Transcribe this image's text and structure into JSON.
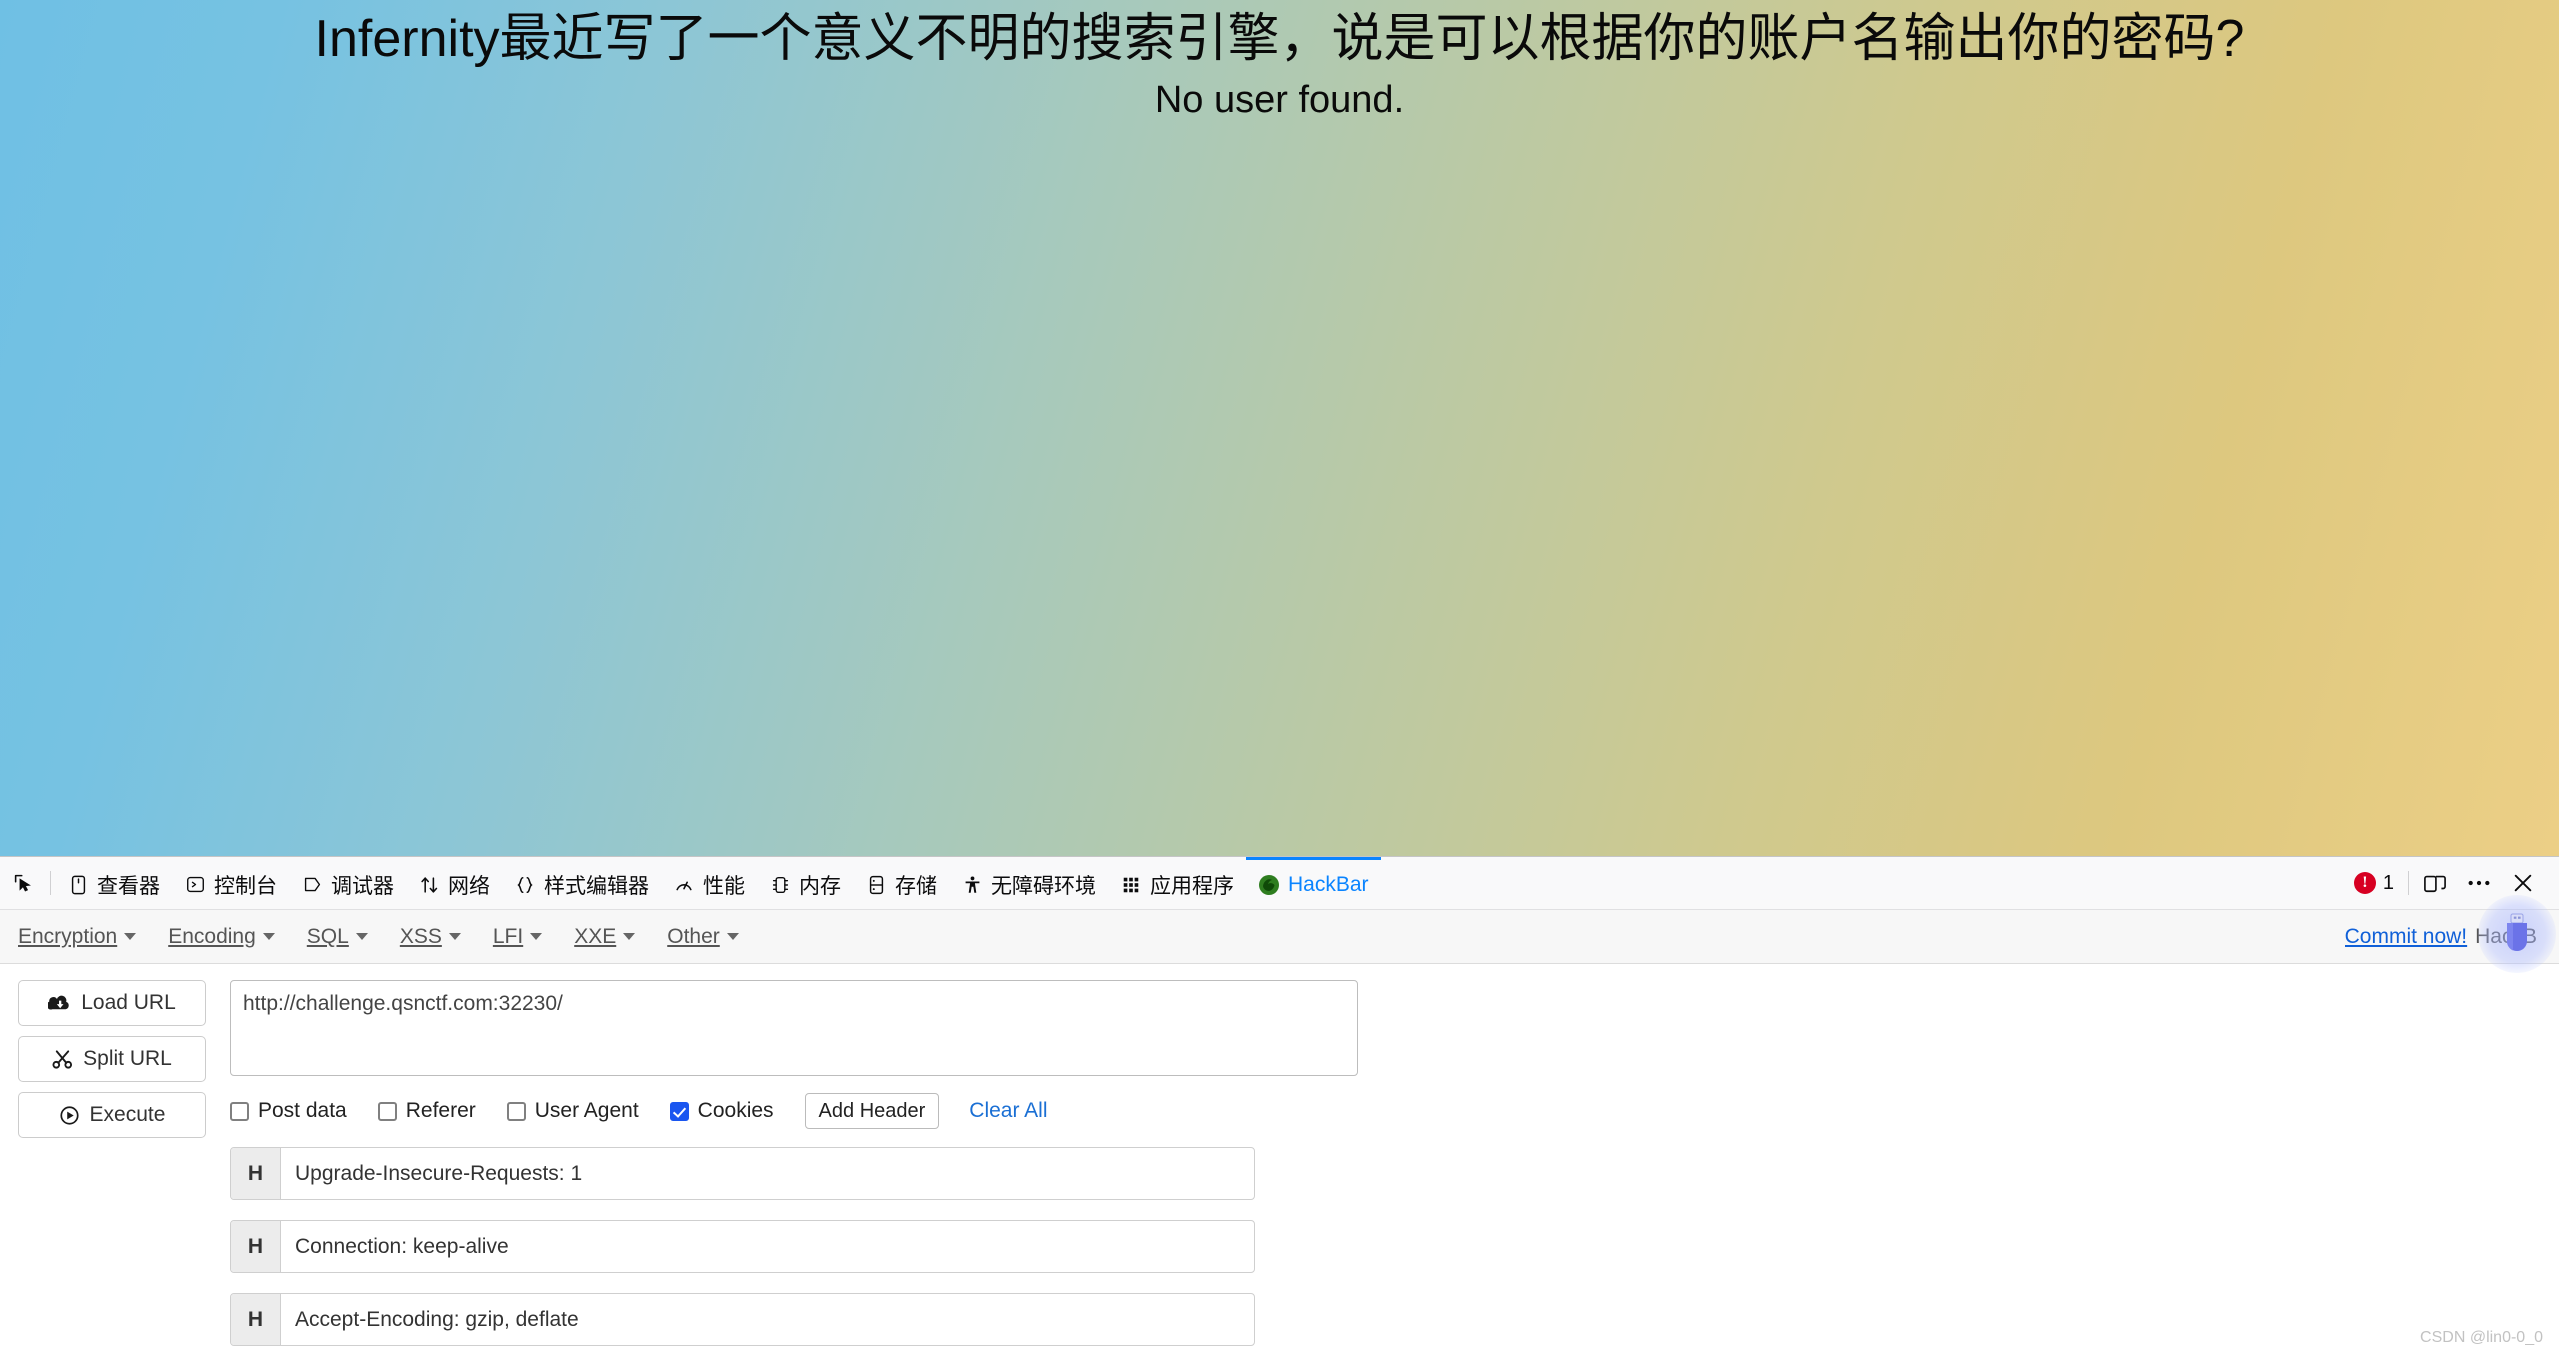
{
  "page": {
    "title": "Infernity最近写了一个意义不明的搜索引擎，说是可以根据你的账户名输出你的密码?",
    "message": "No user found.",
    "background_from": "#6fc0e4",
    "background_to": "#eccf86"
  },
  "devtools": {
    "picker_icon": "element-picker-icon",
    "tabs": [
      {
        "label": "查看器",
        "icon": "inspector-icon",
        "active": false
      },
      {
        "label": "控制台",
        "icon": "console-icon",
        "active": false
      },
      {
        "label": "调试器",
        "icon": "debugger-icon",
        "active": false
      },
      {
        "label": "网络",
        "icon": "network-icon",
        "active": false
      },
      {
        "label": "样式编辑器",
        "icon": "style-editor-icon",
        "active": false
      },
      {
        "label": "性能",
        "icon": "performance-icon",
        "active": false
      },
      {
        "label": "内存",
        "icon": "memory-icon",
        "active": false
      },
      {
        "label": "存储",
        "icon": "storage-icon",
        "active": false
      },
      {
        "label": "无障碍环境",
        "icon": "accessibility-icon",
        "active": false
      },
      {
        "label": "应用程序",
        "icon": "application-icon",
        "active": false
      },
      {
        "label": "HackBar",
        "icon": "hackbar-firefox-icon",
        "active": true
      }
    ],
    "error_badge": {
      "symbol": "!",
      "count": "1",
      "color": "#d70022"
    },
    "responsive_icon": "responsive-design-mode-icon",
    "meatball_icon": "more-options-icon",
    "close_icon": "close-icon",
    "active_tab_accent": "#0a84ff"
  },
  "hackbar": {
    "menus": [
      {
        "label": "Encryption"
      },
      {
        "label": "Encoding"
      },
      {
        "label": "SQL"
      },
      {
        "label": "XSS"
      },
      {
        "label": "LFI"
      },
      {
        "label": "XXE"
      },
      {
        "label": "Other"
      }
    ],
    "commit_link": "Commit now!",
    "brand_text": "HackB",
    "actions": [
      {
        "label": "Load URL",
        "icon": "cloud-download-icon"
      },
      {
        "label": "Split URL",
        "icon": "scissors-icon"
      },
      {
        "label": "Execute",
        "icon": "play-icon"
      }
    ],
    "url_field": {
      "value": "http://challenge.qsnctf.com:32230/",
      "placeholder": "http://"
    },
    "options": [
      {
        "label": "Post data",
        "checked": false
      },
      {
        "label": "Referer",
        "checked": false
      },
      {
        "label": "User Agent",
        "checked": false
      },
      {
        "label": "Cookies",
        "checked": true
      }
    ],
    "add_header_label": "Add Header",
    "clear_all_label": "Clear All",
    "header_tag": "H",
    "headers": [
      {
        "value": "Upgrade-Insecure-Requests: 1"
      },
      {
        "value": "Connection: keep-alive"
      },
      {
        "value": "Accept-Encoding: gzip, deflate"
      }
    ]
  },
  "overlay": {
    "cursor_icon": "usb-drive-icon"
  },
  "watermark": "CSDN @lin0-0_0"
}
